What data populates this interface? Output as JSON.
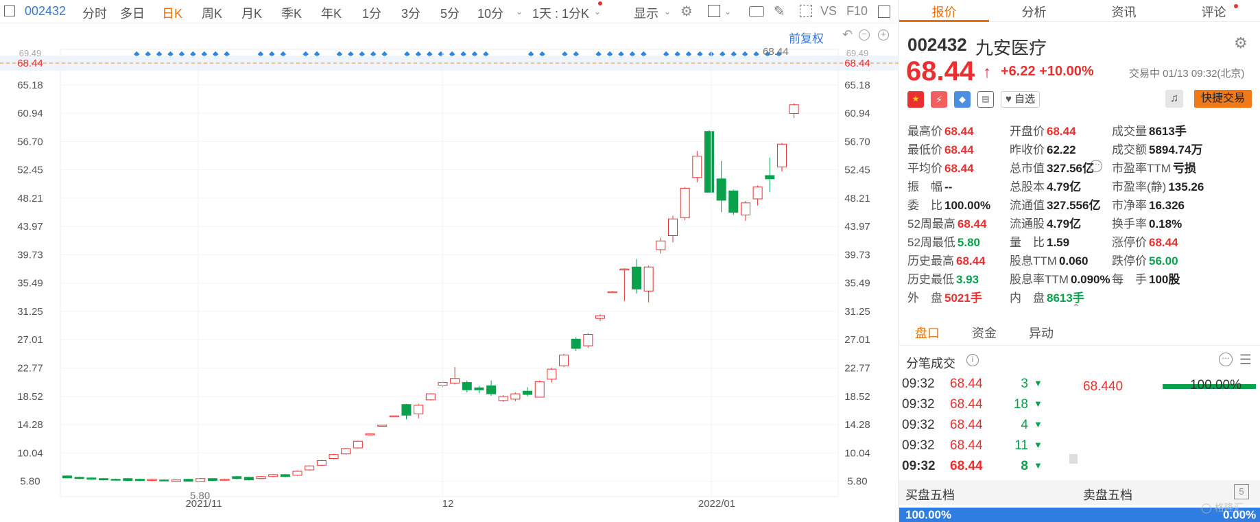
{
  "toolbar": {
    "code": "002432",
    "items": [
      "分时",
      "多日",
      "日K",
      "周K",
      "月K",
      "季K",
      "年K",
      "1分",
      "3分",
      "5分",
      "10分"
    ],
    "active": "日K",
    "period": "1天 : 1分K",
    "display": "显示",
    "vs": "VS",
    "f10": "F10"
  },
  "chart": {
    "adjust_label": "前复权",
    "current_price_label": "68.44",
    "top_label": "68.44",
    "min_label": "5.80",
    "partial_label": "69.49",
    "x_ticks": [
      "2021/11",
      "12",
      "2022/01"
    ],
    "colors": {
      "up": "#e93030",
      "down": "#0aa14d",
      "dots": "#2e86de",
      "price_line": "#f08c2a"
    }
  },
  "chart_data": {
    "type": "candlestick",
    "title": "",
    "ylim": [
      3.5,
      70.5
    ],
    "y_ticks": [
      5.8,
      10.04,
      14.28,
      18.52,
      22.77,
      27.01,
      31.25,
      35.49,
      39.73,
      43.97,
      48.21,
      52.45,
      56.7,
      60.94,
      65.18
    ],
    "x_labels": [
      "2021/11",
      "12",
      "2022/01"
    ],
    "candles": [
      {
        "o": 6.6,
        "c": 6.3,
        "h": 6.7,
        "l": 6.2
      },
      {
        "o": 6.4,
        "c": 6.2,
        "h": 6.5,
        "l": 6.1
      },
      {
        "o": 6.3,
        "c": 6.1,
        "h": 6.4,
        "l": 6.0
      },
      {
        "o": 6.2,
        "c": 6.0,
        "h": 6.3,
        "l": 5.9
      },
      {
        "o": 6.1,
        "c": 6.0,
        "h": 6.2,
        "l": 5.9
      },
      {
        "o": 6.2,
        "c": 5.9,
        "h": 6.3,
        "l": 5.8
      },
      {
        "o": 6.1,
        "c": 5.9,
        "h": 6.2,
        "l": 5.8
      },
      {
        "o": 5.9,
        "c": 6.1,
        "h": 6.2,
        "l": 5.8
      },
      {
        "o": 6.0,
        "c": 5.9,
        "h": 6.1,
        "l": 5.8
      },
      {
        "o": 5.8,
        "c": 6.0,
        "h": 6.1,
        "l": 5.8
      },
      {
        "o": 6.1,
        "c": 5.8,
        "h": 6.2,
        "l": 5.8
      },
      {
        "o": 5.8,
        "c": 6.2,
        "h": 6.3,
        "l": 5.8
      },
      {
        "o": 6.2,
        "c": 5.9,
        "h": 6.3,
        "l": 5.8
      },
      {
        "o": 6.0,
        "c": 6.1,
        "h": 6.2,
        "l": 5.9
      },
      {
        "o": 6.5,
        "c": 6.2,
        "h": 6.6,
        "l": 6.1
      },
      {
        "o": 6.4,
        "c": 6.0,
        "h": 6.5,
        "l": 5.9
      },
      {
        "o": 6.2,
        "c": 6.5,
        "h": 6.6,
        "l": 6.1
      },
      {
        "o": 6.5,
        "c": 6.8,
        "h": 6.9,
        "l": 6.4
      },
      {
        "o": 6.8,
        "c": 6.5,
        "h": 6.9,
        "l": 6.4
      },
      {
        "o": 6.7,
        "c": 7.3,
        "h": 7.4,
        "l": 6.6
      },
      {
        "o": 7.5,
        "c": 8.1,
        "h": 8.2,
        "l": 7.4
      },
      {
        "o": 8.2,
        "c": 8.9,
        "h": 9.0,
        "l": 8.1
      },
      {
        "o": 9.2,
        "c": 9.8,
        "h": 9.9,
        "l": 9.1
      },
      {
        "o": 9.9,
        "c": 10.7,
        "h": 10.8,
        "l": 9.8
      },
      {
        "o": 10.8,
        "c": 11.8,
        "h": 11.9,
        "l": 10.7
      },
      {
        "o": 12.9,
        "c": 12.9,
        "h": 12.9,
        "l": 12.9
      },
      {
        "o": 14.2,
        "c": 14.2,
        "h": 14.2,
        "l": 14.2
      },
      {
        "o": 15.6,
        "c": 15.6,
        "h": 15.6,
        "l": 15.6
      },
      {
        "o": 17.3,
        "c": 15.7,
        "h": 17.4,
        "l": 15.1
      },
      {
        "o": 15.9,
        "c": 17.2,
        "h": 17.4,
        "l": 15.2
      },
      {
        "o": 18.0,
        "c": 18.9,
        "h": 19.0,
        "l": 17.9
      },
      {
        "o": 20.2,
        "c": 20.6,
        "h": 20.8,
        "l": 19.9
      },
      {
        "o": 20.5,
        "c": 21.2,
        "h": 22.9,
        "l": 20.3
      },
      {
        "o": 20.6,
        "c": 19.5,
        "h": 20.9,
        "l": 19.1
      },
      {
        "o": 19.8,
        "c": 19.5,
        "h": 20.1,
        "l": 19.0
      },
      {
        "o": 20.1,
        "c": 18.9,
        "h": 20.9,
        "l": 18.6
      },
      {
        "o": 17.9,
        "c": 18.5,
        "h": 18.7,
        "l": 17.7
      },
      {
        "o": 18.1,
        "c": 18.9,
        "h": 19.1,
        "l": 17.8
      },
      {
        "o": 19.3,
        "c": 18.8,
        "h": 19.9,
        "l": 18.5
      },
      {
        "o": 18.4,
        "c": 20.7,
        "h": 20.9,
        "l": 18.4
      },
      {
        "o": 21.1,
        "c": 22.6,
        "h": 22.8,
        "l": 20.6
      },
      {
        "o": 23.1,
        "c": 24.7,
        "h": 24.9,
        "l": 22.9
      },
      {
        "o": 27.1,
        "c": 25.7,
        "h": 27.4,
        "l": 25.3
      },
      {
        "o": 26.1,
        "c": 27.8,
        "h": 28.0,
        "l": 25.8
      },
      {
        "o": 30.2,
        "c": 30.6,
        "h": 30.8,
        "l": 29.8
      },
      {
        "o": 34.2,
        "c": 34.2,
        "h": 34.3,
        "l": 34.2
      },
      {
        "o": 37.6,
        "c": 37.6,
        "h": 37.7,
        "l": 32.8
      },
      {
        "o": 37.9,
        "c": 34.6,
        "h": 39.1,
        "l": 33.9
      },
      {
        "o": 34.3,
        "c": 37.9,
        "h": 38.1,
        "l": 32.6
      },
      {
        "o": 40.5,
        "c": 41.8,
        "h": 42.3,
        "l": 39.9
      },
      {
        "o": 42.6,
        "c": 45.1,
        "h": 45.6,
        "l": 41.6
      },
      {
        "o": 45.3,
        "c": 49.7,
        "h": 49.9,
        "l": 44.9
      },
      {
        "o": 51.3,
        "c": 54.5,
        "h": 55.3,
        "l": 50.6
      },
      {
        "o": 58.2,
        "c": 49.1,
        "h": 58.4,
        "l": 49.1
      },
      {
        "o": 51.1,
        "c": 47.9,
        "h": 53.8,
        "l": 46.1
      },
      {
        "o": 49.3,
        "c": 46.1,
        "h": 49.5,
        "l": 45.7
      },
      {
        "o": 45.7,
        "c": 47.5,
        "h": 47.8,
        "l": 44.8
      },
      {
        "o": 48.1,
        "c": 49.9,
        "h": 50.1,
        "l": 47.1
      },
      {
        "o": 51.6,
        "c": 51.1,
        "h": 54.3,
        "l": 49.1
      },
      {
        "o": 52.9,
        "c": 56.3,
        "h": 56.5,
        "l": 52.2
      },
      {
        "o": 60.9,
        "c": 62.2,
        "h": 62.4,
        "l": 60.2
      }
    ]
  },
  "quote": {
    "code": "002432",
    "name": "九安医疗",
    "price": "68.44",
    "change": "+6.22",
    "pct": "+10.00%",
    "status": "交易中 01/13 09:32(北京)",
    "follow": "自选",
    "quick_trade": "快捷交易",
    "fields": [
      [
        {
          "label": "最高价",
          "value": "68.44",
          "color": "red"
        },
        {
          "label": "开盘价",
          "value": "68.44",
          "color": "red"
        },
        {
          "label": "成交量",
          "value": "8613手",
          "color": "dark"
        }
      ],
      [
        {
          "label": "最低价",
          "value": "68.44",
          "color": "red"
        },
        {
          "label": "昨收价",
          "value": "62.22",
          "color": "dark"
        },
        {
          "label": "成交额",
          "value": "5894.74万",
          "color": "dark"
        }
      ],
      [
        {
          "label": "平均价",
          "value": "68.44",
          "color": "red"
        },
        {
          "label": "总市值",
          "value": "327.56亿",
          "color": "dark"
        },
        {
          "label": "市盈率TTM",
          "value": "亏损",
          "color": "dark"
        }
      ],
      [
        {
          "label": "振　幅",
          "value": "--",
          "color": "dark"
        },
        {
          "label": "总股本",
          "value": "4.79亿",
          "color": "dark"
        },
        {
          "label": "市盈率(静)",
          "value": "135.26",
          "color": "dark"
        }
      ],
      [
        {
          "label": "委　比",
          "value": "100.00%",
          "color": "dark"
        },
        {
          "label": "流通值",
          "value": "327.556亿",
          "color": "dark"
        },
        {
          "label": "市净率",
          "value": "16.326",
          "color": "dark"
        }
      ],
      [
        {
          "label": "52周最高",
          "value": "68.44",
          "color": "red"
        },
        {
          "label": "流通股",
          "value": "4.79亿",
          "color": "dark"
        },
        {
          "label": "换手率",
          "value": "0.18%",
          "color": "dark"
        }
      ],
      [
        {
          "label": "52周最低",
          "value": "5.80",
          "color": "green"
        },
        {
          "label": "量　比",
          "value": "1.59",
          "color": "dark"
        },
        {
          "label": "涨停价",
          "value": "68.44",
          "color": "red"
        }
      ],
      [
        {
          "label": "历史最高",
          "value": "68.44",
          "color": "red"
        },
        {
          "label": "股息TTM",
          "value": "0.060",
          "color": "dark"
        },
        {
          "label": "跌停价",
          "value": "56.00",
          "color": "green"
        }
      ],
      [
        {
          "label": "历史最低",
          "value": "3.93",
          "color": "green"
        },
        {
          "label": "股息率TTM",
          "value": "0.090%",
          "color": "dark"
        },
        {
          "label": "每　手",
          "value": "100股",
          "color": "dark"
        }
      ],
      [
        {
          "label": "外　盘",
          "value": "5021手",
          "color": "red"
        },
        {
          "label": "内　盘",
          "value": "8613手",
          "color": "green"
        },
        null
      ]
    ]
  },
  "right_tabs": [
    "报价",
    "分析",
    "资讯",
    "评论"
  ],
  "sub_tabs": [
    "盘口",
    "资金",
    "异动"
  ],
  "ticks": {
    "title": "分笔成交",
    "rows": [
      {
        "time": "09:32",
        "price": "68.44",
        "vol": "3"
      },
      {
        "time": "09:32",
        "price": "68.44",
        "vol": "18"
      },
      {
        "time": "09:32",
        "price": "68.44",
        "vol": "4"
      },
      {
        "time": "09:32",
        "price": "68.44",
        "vol": "11"
      },
      {
        "time": "09:32",
        "price": "68.44",
        "vol": "8"
      }
    ],
    "dist_price": "68.440",
    "dist_pct": "100.00%"
  },
  "book": {
    "buy_label": "买盘五档",
    "sell_label": "卖盘五档",
    "buy_pct": "100.00%",
    "sell_pct": "0.00%",
    "watermark": "格隆汇"
  }
}
